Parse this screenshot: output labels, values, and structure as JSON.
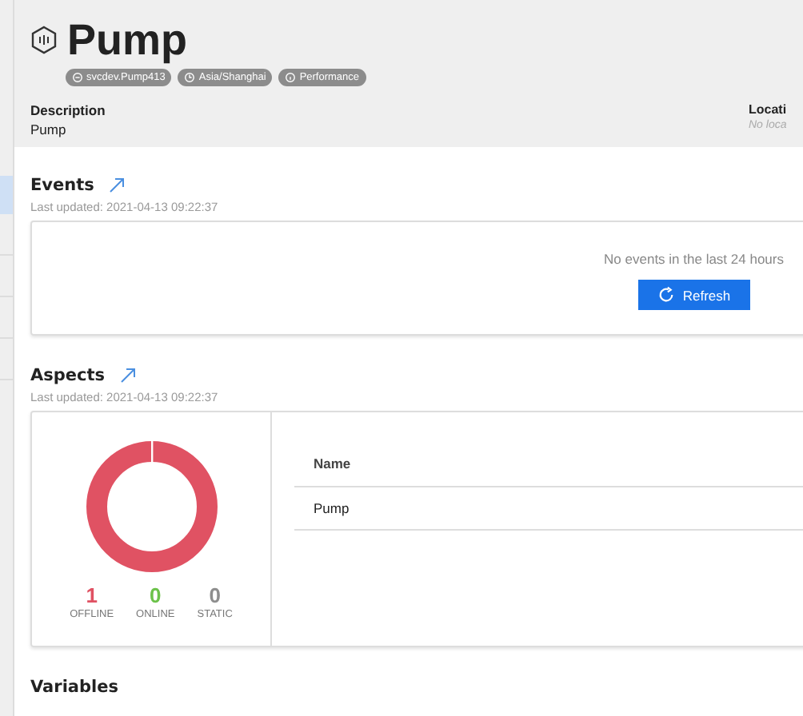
{
  "asset": {
    "title": "Pump",
    "badges": [
      {
        "kind": "id",
        "label": "svcdev.Pump413"
      },
      {
        "kind": "timezone",
        "label": "Asia/Shanghai"
      },
      {
        "kind": "info",
        "label": "Performance"
      }
    ],
    "description": {
      "label": "Description",
      "value": "Pump"
    },
    "location": {
      "label": "Locati",
      "value": "No loca"
    }
  },
  "events": {
    "title": "Events",
    "updated": "Last updated: 2021-04-13 09:22:37",
    "message": "No events in the last 24 hours",
    "button": "Refresh"
  },
  "aspects": {
    "title": "Aspects",
    "updated": "Last updated: 2021-04-13 09:22:37",
    "statuses": [
      {
        "count": "1",
        "label": "OFFLINE",
        "color": "#e05263"
      },
      {
        "count": "0",
        "label": "ONLINE",
        "color": "#6cc24a"
      },
      {
        "count": "0",
        "label": "STATIC",
        "color": "#8e8e8e"
      }
    ],
    "table": {
      "columns": [
        "Name"
      ],
      "rows": [
        [
          "Pump"
        ]
      ]
    }
  },
  "variables": {
    "title": "Variables"
  }
}
